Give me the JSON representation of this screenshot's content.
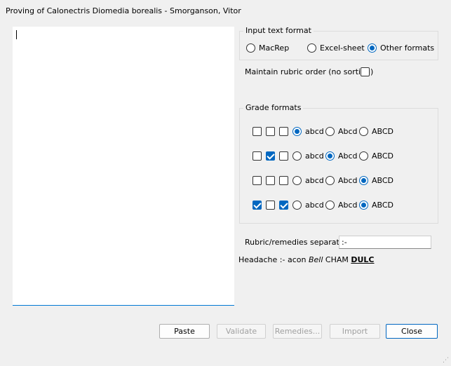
{
  "window": {
    "title": "Proving of Calonectris Diomedia borealis - Smorganson, Vitor"
  },
  "input_format": {
    "legend": "Input text format",
    "options": [
      {
        "label": "MacRep",
        "checked": false
      },
      {
        "label": "Excel-sheet",
        "checked": false
      },
      {
        "label": "Other formats",
        "checked": true
      }
    ]
  },
  "maintain_order": {
    "label": "Maintain rubric order (no sorting)",
    "checked": false
  },
  "grade_formats": {
    "legend": "Grade formats",
    "radio_labels": [
      "abcd",
      "Abcd",
      "ABCD"
    ],
    "rows": [
      {
        "checks": [
          false,
          false,
          false
        ],
        "selected": 0
      },
      {
        "checks": [
          false,
          true,
          false
        ],
        "selected": 1
      },
      {
        "checks": [
          false,
          false,
          false
        ],
        "selected": 2
      },
      {
        "checks": [
          true,
          false,
          true
        ],
        "selected": 2
      }
    ]
  },
  "separator": {
    "label": "Rubric/remedies separator",
    "value": ":-"
  },
  "example": {
    "rubric": "Headache :- acon ",
    "italic": "Bell",
    "plain": " CHAM ",
    "bold": "DULC"
  },
  "buttons": {
    "paste": "Paste",
    "validate": "Validate",
    "remedies": "Remedies...",
    "import": "Import",
    "close": "Close"
  },
  "colors": {
    "accent": "#0067c0",
    "background": "#f0f0f0"
  }
}
